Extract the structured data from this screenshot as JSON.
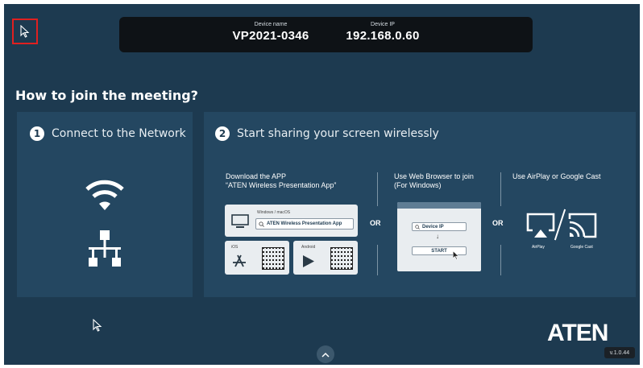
{
  "device": {
    "name_label": "Device name",
    "name_value": "VP2021-0346",
    "ip_label": "Device IP",
    "ip_value": "192.168.0.60"
  },
  "main": {
    "title": "How to join the meeting?",
    "step1": {
      "number": "1",
      "title": "Connect to the Network"
    },
    "step2": {
      "number": "2",
      "title": "Start sharing your screen wirelessly",
      "app": {
        "heading_line1": "Download the APP",
        "heading_line2": "“ATEN Wireless Presentation App”",
        "desktop_label": "Windows / macOS",
        "search_text": "ATEN Wireless Presentation App",
        "ios_label": "iOS",
        "android_label": "Android"
      },
      "or_label": "OR",
      "web": {
        "heading_line1": "Use Web Browser to join",
        "heading_line2": "(For Windows)",
        "ip_field": "Device IP",
        "arrow": "↓",
        "start_button": "START"
      },
      "cast": {
        "heading": "Use AirPlay or Google Cast",
        "airplay_label": "AirPlay",
        "googlecast_label": "Google Cast"
      }
    }
  },
  "footer": {
    "logo": "ATEN",
    "version": "v.1.0.44"
  },
  "colors": {
    "background": "#1d3a50",
    "panel": "#244761",
    "device_bar": "#0e1216",
    "highlight": "#e02020"
  },
  "icons": [
    "cursor-icon",
    "wifi-icon",
    "network-icon",
    "monitor-icon",
    "search-icon",
    "app-store-icon",
    "play-store-icon",
    "airplay-icon",
    "google-cast-icon",
    "chevron-up-icon"
  ]
}
